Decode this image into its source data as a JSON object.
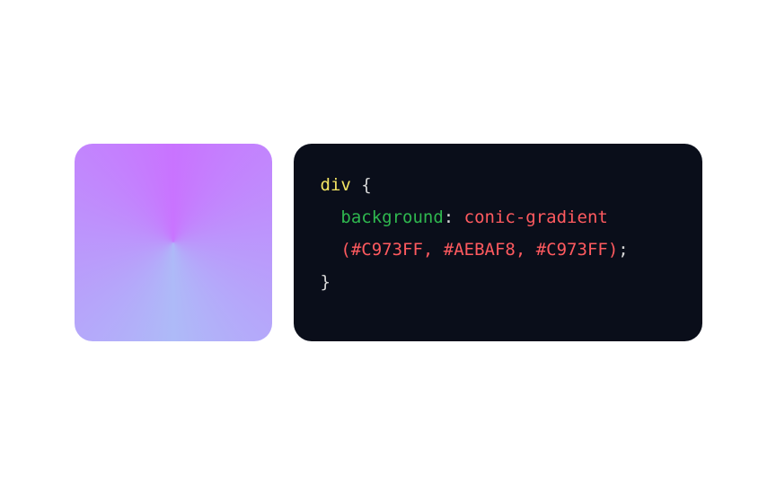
{
  "preview": {
    "gradient_colors": [
      "#C973FF",
      "#AEBAF8",
      "#C973FF"
    ]
  },
  "code": {
    "selector": "div",
    "brace_open": " {",
    "property_indent": "  ",
    "property": "background",
    "colon": ": ",
    "function": "conic-gradient",
    "args_indent": "  ",
    "args_open": "(",
    "args_inner": "#C973FF, #AEBAF8, #C973FF",
    "args_close": ")",
    "semicolon": ";",
    "brace_close": "}"
  }
}
